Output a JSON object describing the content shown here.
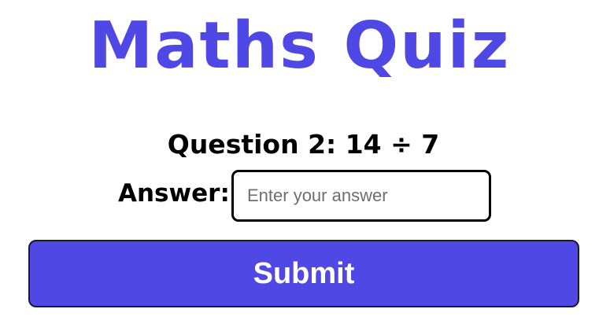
{
  "quiz": {
    "title": "Maths Quiz",
    "question": "Question 2: 14 ÷ 7",
    "answer_label": "Answer:",
    "answer_value": "",
    "answer_placeholder": "Enter your answer",
    "submit_label": "Submit"
  },
  "colors": {
    "accent": "#5048e5",
    "text": "#000000",
    "button_text": "#ffffff"
  }
}
